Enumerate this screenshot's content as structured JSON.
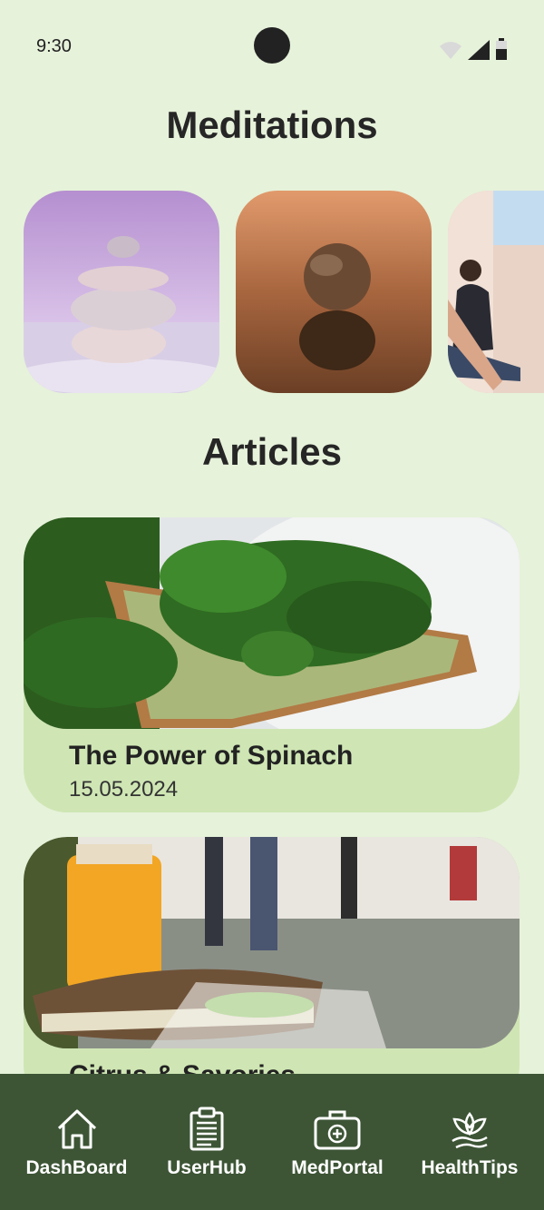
{
  "status_bar": {
    "time": "9:30"
  },
  "meditations": {
    "title": "Meditations",
    "items": [
      {
        "icon": "stacked-stones-image"
      },
      {
        "icon": "two-stones-image"
      },
      {
        "icon": "yoga-class-image"
      }
    ]
  },
  "articles": {
    "title": "Articles",
    "items": [
      {
        "title": "The Power of Spinach",
        "date": "15.05.2024",
        "icon": "spinach-toast-image"
      },
      {
        "title": "Citrus & Savories",
        "date": "",
        "icon": "juice-sandwich-image"
      }
    ]
  },
  "bottom_nav": {
    "items": [
      {
        "label": "DashBoard",
        "icon": "home-icon"
      },
      {
        "label": "UserHub",
        "icon": "clipboard-icon"
      },
      {
        "label": "MedPortal",
        "icon": "medical-kit-icon"
      },
      {
        "label": "HealthTips",
        "icon": "lotus-icon"
      }
    ]
  },
  "colors": {
    "background": "#e6f2da",
    "card": "#cfe6b4",
    "nav": "#3d5535"
  }
}
